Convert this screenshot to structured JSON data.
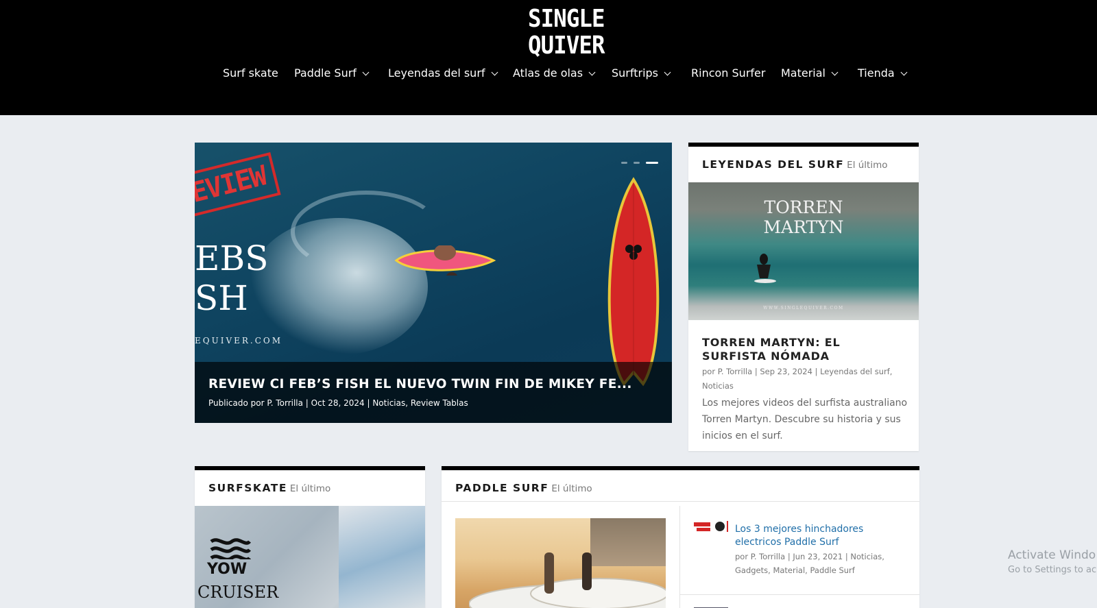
{
  "site": {
    "logo_line1": "SINGLE",
    "logo_line2": "QUIVER"
  },
  "nav": {
    "items": [
      {
        "label": "Surf skate",
        "dropdown": false
      },
      {
        "label": "Paddle Surf",
        "dropdown": true
      },
      {
        "label": "Leyendas del surf",
        "dropdown": true
      },
      {
        "label": "Atlas de olas",
        "dropdown": true
      },
      {
        "label": "Surftrips",
        "dropdown": true
      },
      {
        "label": "Rincon Surfer",
        "dropdown": false
      },
      {
        "label": "Material",
        "dropdown": true
      },
      {
        "label": "Tienda",
        "dropdown": true
      }
    ]
  },
  "hero": {
    "stamp_text": "EVIEW",
    "big_text_line1": "EBS",
    "big_text_line2": "SH",
    "site_text": "EQUIVER.COM",
    "slides_total": 3,
    "active_slide": 3,
    "title": "REVIEW CI FEB’S FISH EL NUEVO TWIN FIN DE MIKEY FE...",
    "meta": "Publicado por P. Torrilla | Oct 28, 2024 | Noticias, Review Tablas"
  },
  "leyendas": {
    "category": "LEYENDAS DEL SURF",
    "subtitle": "El último",
    "image_title_line1": "TORREN",
    "image_title_line2": "MARTYN",
    "image_site": "WWW.SINGLEQUIVER.COM",
    "post_title": "TORREN MARTYN: EL SURFISTA NÓMADA",
    "post_meta": "por P. Torrilla | Sep 23, 2024 | Leyendas del surf, Noticias",
    "post_excerpt": "Los mejores videos del surfista australiano Torren Martyn. Descubre su historia y sus inicios en el surf."
  },
  "surfskate": {
    "category": "SURFSKATE",
    "subtitle": "El último",
    "image_logo": "YOW",
    "image_text": "CRUISER"
  },
  "paddle": {
    "category": "PADDLE SURF",
    "subtitle": "El último",
    "side_post": {
      "title": "Los 3 mejores hinchadores electricos Paddle Surf",
      "meta": "por P. Torrilla | Jun 23, 2021 | Noticias, Gadgets, Material, Paddle Surf"
    }
  },
  "os_watermark": {
    "line1": "Activate Windo",
    "line2": "Go to Settings to ac"
  },
  "colors": {
    "header_bg": "#000000",
    "page_bg": "#eaedf1",
    "link_blue": "#1f6ea8"
  }
}
